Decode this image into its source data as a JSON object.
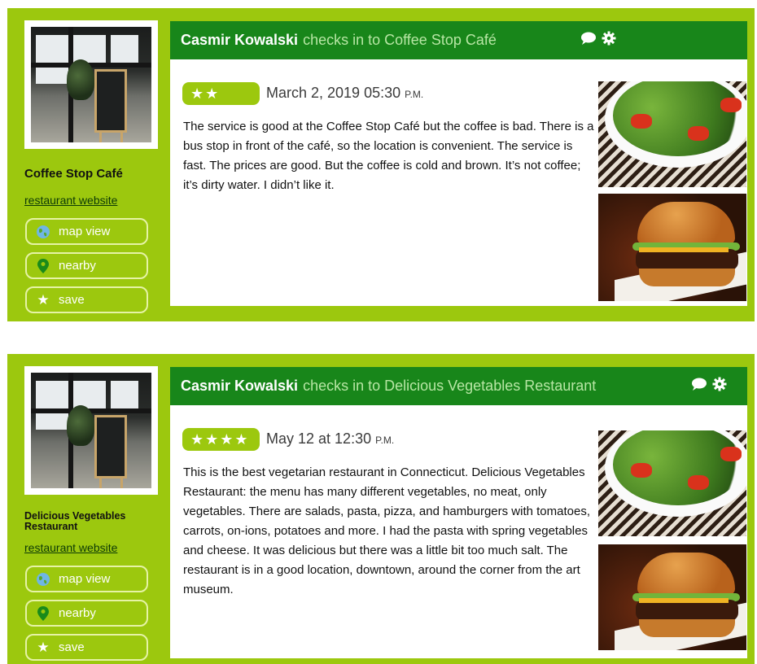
{
  "checkins": [
    {
      "place": "Coffee Stop Café",
      "website_link": "restaurant website",
      "buttons": {
        "map": "map view",
        "nearby": "nearby",
        "save": "save"
      },
      "user": "Casmir Kowalski",
      "action": "checks in to Coffee Stop Café",
      "stars": "★★",
      "rating": 2,
      "date": "March 2, 2019 05:30",
      "ampm": "P.M.",
      "review": "The service is good at the Coffee Stop Café but the coffee is bad. There is a bus stop in front of the café, so the location is convenient. The service is fast. The prices are good. But the coffee is cold and brown. It’s not coffee; it’s dirty water. I didn’t like it."
    },
    {
      "place": "Delicious Vegetables Restaurant",
      "website_link": "restaurant website",
      "buttons": {
        "map": "map view",
        "nearby": "nearby",
        "save": "save"
      },
      "user": "Casmir Kowalski",
      "action": "checks in to Delicious Vegetables Restaurant",
      "stars": "★★★★",
      "rating": 4,
      "date": "May 12 at 12:30",
      "ampm": "P.M.",
      "review": "This is the best vegetarian restaurant in Connecticut. Delicious Vegetables Restaurant: the menu has many different vegetables, no meat, only vegetables. There are salads, pasta, pizza, and hamburgers with tomatoes, carrots, on-ions, potatoes and more. I had the pasta with spring vegetables and cheese. It was delicious but there was a little bit too much salt. The restaurant is in a good location, downtown, around the corner from the art museum."
    }
  ],
  "colors": {
    "card_green": "#9cc80e",
    "header_green": "#18861a",
    "action_text": "#b7e6a4"
  },
  "icons": [
    "globe-icon",
    "pin-icon",
    "star-icon",
    "comment-icon",
    "gear-icon"
  ]
}
